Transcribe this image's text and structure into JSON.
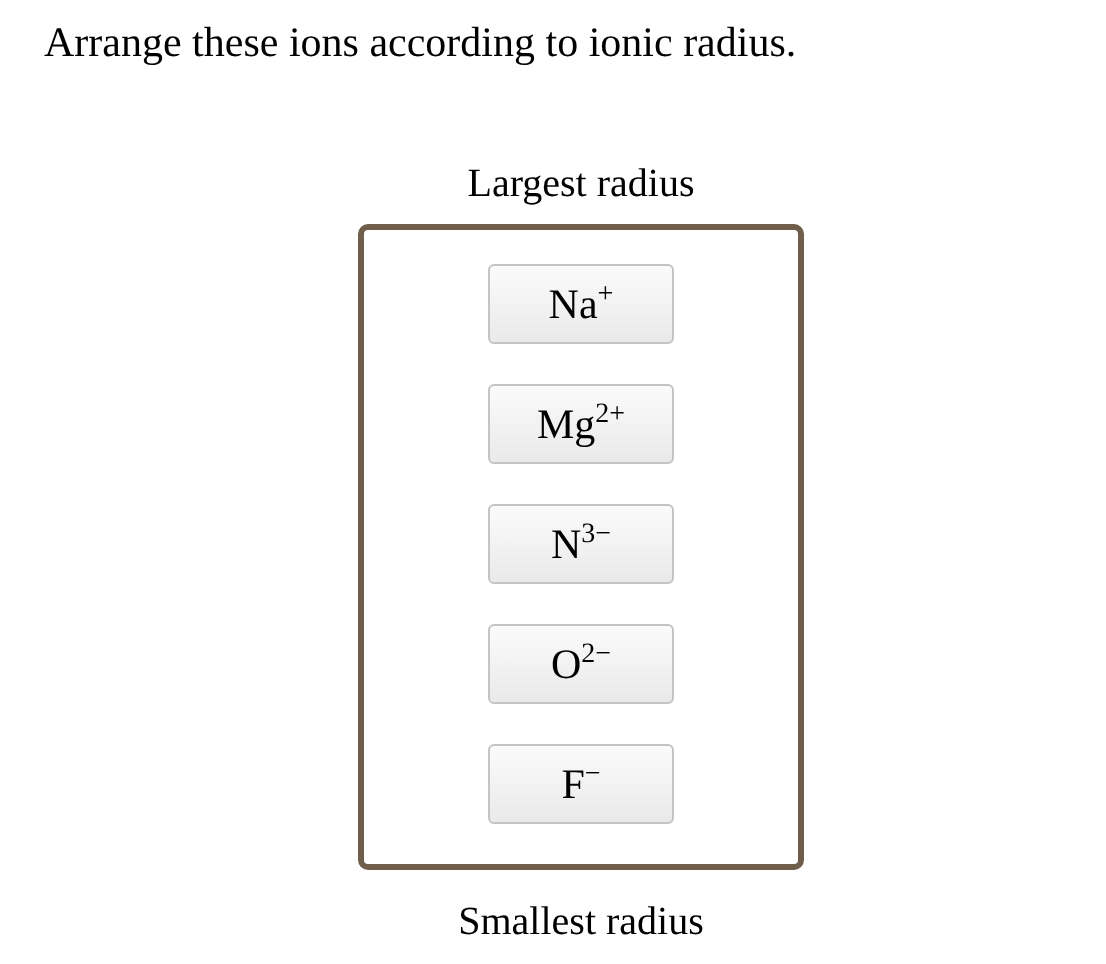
{
  "question": "Arrange these ions according to ionic radius.",
  "top_label": "Largest radius",
  "ions": [
    {
      "label": "Na$^{+}$"
    },
    {
      "label": "Mg$^{2+}$"
    },
    {
      "label": "N$^{3−}$"
    },
    {
      "label": "O$^{2−}$"
    },
    {
      "label": "F$^{−}$"
    }
  ],
  "bottom_label": "Smallest radius"
}
